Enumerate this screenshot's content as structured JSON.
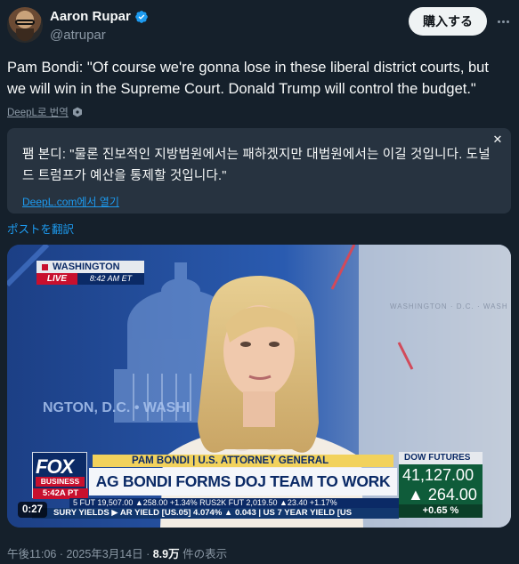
{
  "author": {
    "name": "Aaron Rupar",
    "handle": "@atrupar"
  },
  "header": {
    "subscribe_label": "購入する"
  },
  "tweet": {
    "text": "Pam Bondi: \"Of course we're gonna lose in these liberal district courts, but we will win in the Supreme Court. Donald Trump will control the budget.\"",
    "translation_source": "DeepL로 번역"
  },
  "translation": {
    "text": "팸 본디: \"물론 진보적인 지방법원에서는 패하겠지만 대법원에서는 이길 것입니다. 도널드 트럼프가 예산을 통제할 것입니다.\"",
    "open_link": "DeepL.com에서 열기"
  },
  "translate_post_label": "ポストを翻訳",
  "video": {
    "duration": "0:27",
    "location": "WASHINGTON",
    "live_label": "LIVE",
    "live_time": "8:42 AM ET",
    "network": "FOX",
    "network_sub": "BUSINESS",
    "network_time": "5:42A PT",
    "name_bar": "PAM BONDI | U.S. ATTORNEY GENERAL",
    "headline": "AG BONDI FORMS DOJ TEAM TO WORK WITH DOGE",
    "backdrop_text": "NGTON, D.C. • WASHI",
    "dow_label": "DOW FUTURES",
    "dow_value": "41,127.00",
    "dow_change": "▲ 264.00",
    "dow_pct": "+0.65 %",
    "ticker_top": "5 FUT  19,507.00 ▲258.00 +1.34%  RUS2K FUT  2,019.50 ▲23.40 +1.17%",
    "ticker_bottom": "SURY YIELDS ▶ AR YIELD [US.05]  4.074% ▲ 0.043 | US 7 YEAR YIELD [US"
  },
  "meta": {
    "timestamp": "午後11:06 · 2025年3月14日 · ",
    "views_count": "8.9万",
    "views_label": " 件の表示"
  },
  "colors": {
    "background": "#15202b",
    "accent": "#1d9bf0",
    "secondary_text": "#8b98a5"
  }
}
